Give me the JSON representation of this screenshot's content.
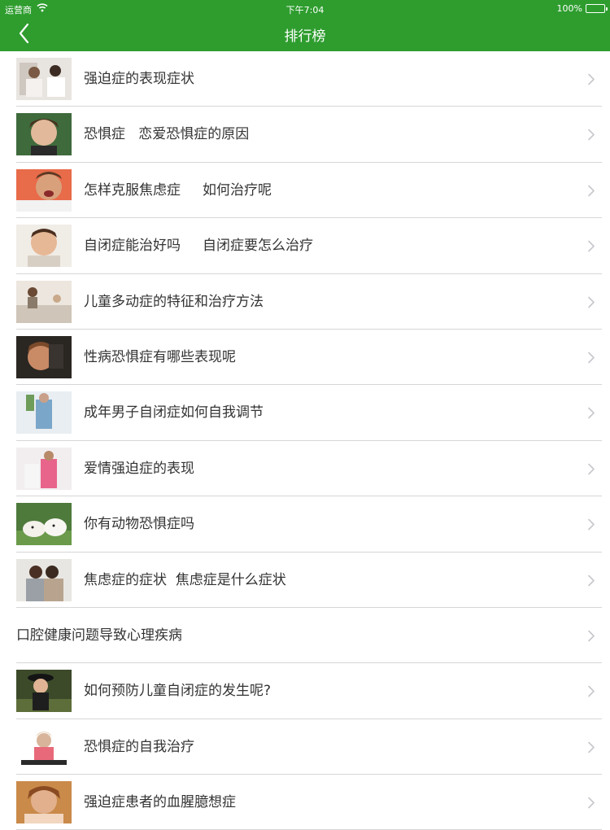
{
  "status_bar": {
    "carrier": "运营商",
    "time": "下午7:04",
    "battery": "100%"
  },
  "navbar": {
    "title": "排行榜",
    "back_icon": "chevron-left-icon"
  },
  "colors": {
    "header_bg": "#2e9d2e",
    "divider": "#d6d6d6",
    "text": "#333333",
    "chevron": "#c7c7cc"
  },
  "list": {
    "items": [
      {
        "label": "强迫症的表现症状",
        "has_thumbnail": true
      },
      {
        "label": "恐惧症   恋爱恐惧症的原因",
        "has_thumbnail": true
      },
      {
        "label": "怎样克服焦虑症     如何治疗呢",
        "has_thumbnail": true
      },
      {
        "label": "自闭症能治好吗     自闭症要怎么治疗",
        "has_thumbnail": true
      },
      {
        "label": "儿童多动症的特征和治疗方法",
        "has_thumbnail": true
      },
      {
        "label": "性病恐惧症有哪些表现呢",
        "has_thumbnail": true
      },
      {
        "label": "成年男子自闭症如何自我调节",
        "has_thumbnail": true
      },
      {
        "label": "爱情强迫症的表现",
        "has_thumbnail": true
      },
      {
        "label": "你有动物恐惧症吗",
        "has_thumbnail": true
      },
      {
        "label": "焦虑症的症状  焦虑症是什么症状",
        "has_thumbnail": true
      },
      {
        "label": "口腔健康问题导致心理疾病",
        "has_thumbnail": false
      },
      {
        "label": "如何预防儿童自闭症的发生呢?",
        "has_thumbnail": true
      },
      {
        "label": "恐惧症的自我治疗",
        "has_thumbnail": true
      },
      {
        "label": "强迫症患者的血腥臆想症",
        "has_thumbnail": true
      }
    ]
  }
}
